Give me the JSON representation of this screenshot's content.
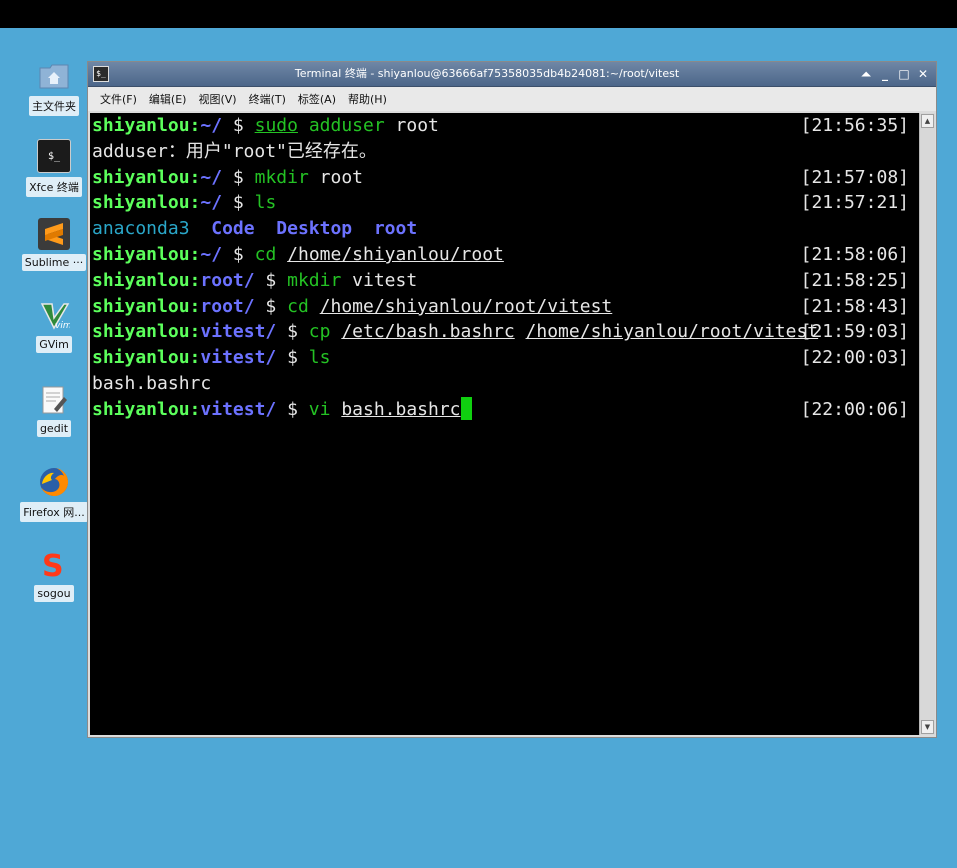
{
  "desktop": {
    "icons": [
      {
        "label": "主文件夹",
        "icon": "home-folder-icon"
      },
      {
        "label": "Xfce 终端",
        "icon": "terminal-icon"
      },
      {
        "label": "Sublime ···",
        "icon": "sublime-icon"
      },
      {
        "label": "GVim",
        "icon": "gvim-icon"
      },
      {
        "label": "gedit",
        "icon": "gedit-icon"
      },
      {
        "label": "Firefox 网...",
        "icon": "firefox-icon"
      },
      {
        "label": "sogou",
        "icon": "sogou-icon"
      }
    ]
  },
  "window": {
    "title": "Terminal 终端 - shiyanlou@63666af75358035db4b24081:~/root/vitest",
    "controls": {
      "shade": "⏶",
      "minimize": "_",
      "maximize": "□",
      "close": "✕"
    },
    "menu": [
      "文件(F)",
      "编辑(E)",
      "视图(V)",
      "终端(T)",
      "标签(A)",
      "帮助(H)"
    ]
  },
  "terminal": {
    "user": "shiyanlou",
    "lines": [
      {
        "dir": "~/",
        "cmd": "sudo",
        "arg1": "adduser",
        "arg2": "root",
        "ts": "[21:56:35]"
      },
      {
        "output": "adduser：用户\"root\"已经存在。"
      },
      {
        "dir": "~/",
        "cmd": "mkdir",
        "arg": "root",
        "ts": "[21:57:08]"
      },
      {
        "dir": "~/",
        "cmd": "ls",
        "ts": "[21:57:21]"
      },
      {
        "ls": [
          "anaconda3",
          "Code",
          "Desktop",
          "root"
        ]
      },
      {
        "dir": "~/",
        "cmd": "cd",
        "arg": "/home/shiyanlou/root",
        "ts": "[21:58:06]"
      },
      {
        "dir": "root/",
        "cmd": "mkdir",
        "arg": "vitest",
        "ts": "[21:58:25]"
      },
      {
        "dir": "root/",
        "cmd": "cd",
        "arg": "/home/shiyanlou/root/vitest",
        "ts": "[21:58:43]"
      },
      {
        "dir": "vitest/",
        "cmd": "cp",
        "arg1": "/etc/bash.bashrc",
        "arg2": "/home/shiyanlou/root/vitest",
        "ts": "[21:59:03]"
      },
      {
        "dir": "vitest/",
        "cmd": "ls",
        "ts": "[22:00:03]"
      },
      {
        "output": "bash.bashrc"
      },
      {
        "dir": "vitest/",
        "cmd": "vi",
        "arg": "bash.bashrc",
        "ts": "[22:00:06]"
      }
    ],
    "prompt_sep": ":",
    "prompt_sign": "$"
  },
  "colors": {
    "desktop_bg": "#4fa8d6",
    "terminal_bg": "#000000",
    "user_green": "#5cff5c",
    "dir_blue": "#6c72ff",
    "cmd_green": "#24c224",
    "cursor": "#10d010"
  }
}
